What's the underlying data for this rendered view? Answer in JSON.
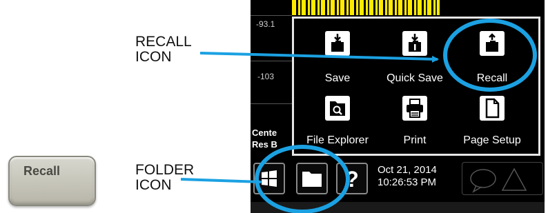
{
  "callouts": {
    "recall_icon_line1": "RECALL",
    "recall_icon_line2": "ICON",
    "folder_icon_line1": "FOLDER",
    "folder_icon_line2": "ICON"
  },
  "hardware_key": {
    "label": "Recall"
  },
  "screen": {
    "y_tick_1": "-93.1",
    "y_tick_2": "-103",
    "center_label": "Cente",
    "res_label": "Res B",
    "menu": {
      "items": [
        {
          "label": "Save",
          "icon": "save-icon"
        },
        {
          "label": "Quick Save",
          "icon": "quick-save-icon"
        },
        {
          "label": "Recall",
          "icon": "recall-icon"
        },
        {
          "label": "File Explorer",
          "icon": "file-explorer-icon"
        },
        {
          "label": "Print",
          "icon": "print-icon"
        },
        {
          "label": "Page Setup",
          "icon": "page-setup-icon"
        }
      ]
    },
    "taskbar": {
      "date": "Oct 21, 2014",
      "time": "10:26:53 PM"
    }
  },
  "colors": {
    "highlight_circle": "#1ba1e2",
    "arrow": "#1ba1e2",
    "trace": "#ffea00",
    "screen_bg": "#000000",
    "key_face": "#c9c8bd"
  }
}
